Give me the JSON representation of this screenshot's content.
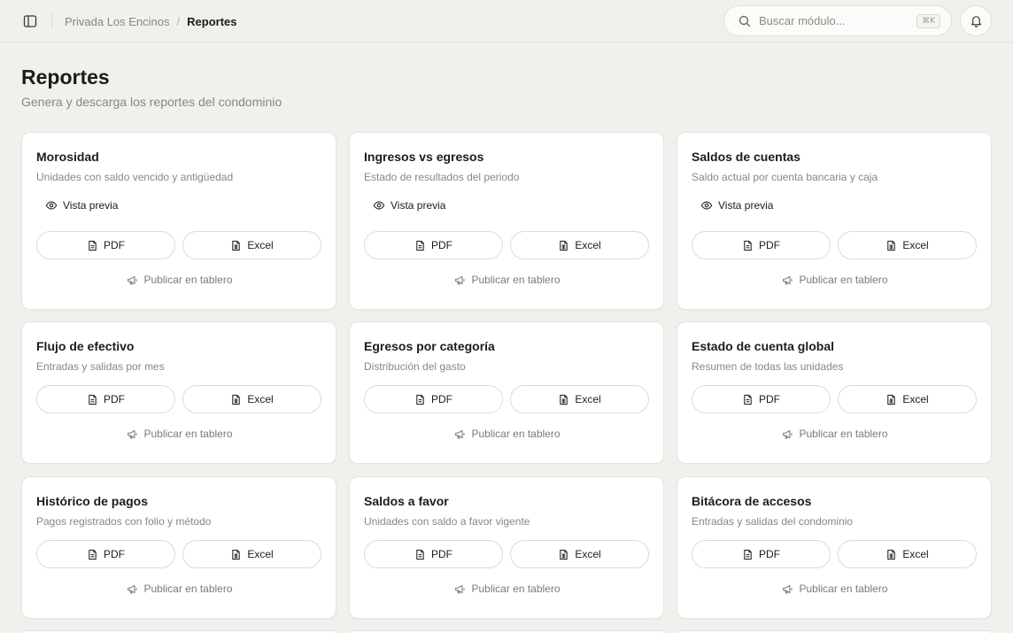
{
  "topbar": {
    "breadcrumb": {
      "parent": "Privada Los Encinos",
      "separator": "/",
      "current": "Reportes"
    },
    "search": {
      "placeholder": "Buscar módulo...",
      "shortcut": "⌘K"
    }
  },
  "header": {
    "title": "Reportes",
    "subtitle": "Genera y descarga los reportes del condominio"
  },
  "labels": {
    "preview": "Vista previa",
    "pdf": "PDF",
    "excel": "Excel",
    "publish": "Publicar en tablero"
  },
  "reports": [
    {
      "title": "Morosidad",
      "description": "Unidades con saldo vencido y antigüedad",
      "has_preview": true
    },
    {
      "title": "Ingresos vs egresos",
      "description": "Estado de resultados del periodo",
      "has_preview": true
    },
    {
      "title": "Saldos de cuentas",
      "description": "Saldo actual por cuenta bancaria y caja",
      "has_preview": true
    },
    {
      "title": "Flujo de efectivo",
      "description": "Entradas y salidas por mes",
      "has_preview": false
    },
    {
      "title": "Egresos por categoría",
      "description": "Distribución del gasto",
      "has_preview": false
    },
    {
      "title": "Estado de cuenta global",
      "description": "Resumen de todas las unidades",
      "has_preview": false
    },
    {
      "title": "Histórico de pagos",
      "description": "Pagos registrados con folio y método",
      "has_preview": false
    },
    {
      "title": "Saldos a favor",
      "description": "Unidades con saldo a favor vigente",
      "has_preview": false
    },
    {
      "title": "Bitácora de accesos",
      "description": "Entradas y salidas del condominio",
      "has_preview": false
    }
  ]
}
